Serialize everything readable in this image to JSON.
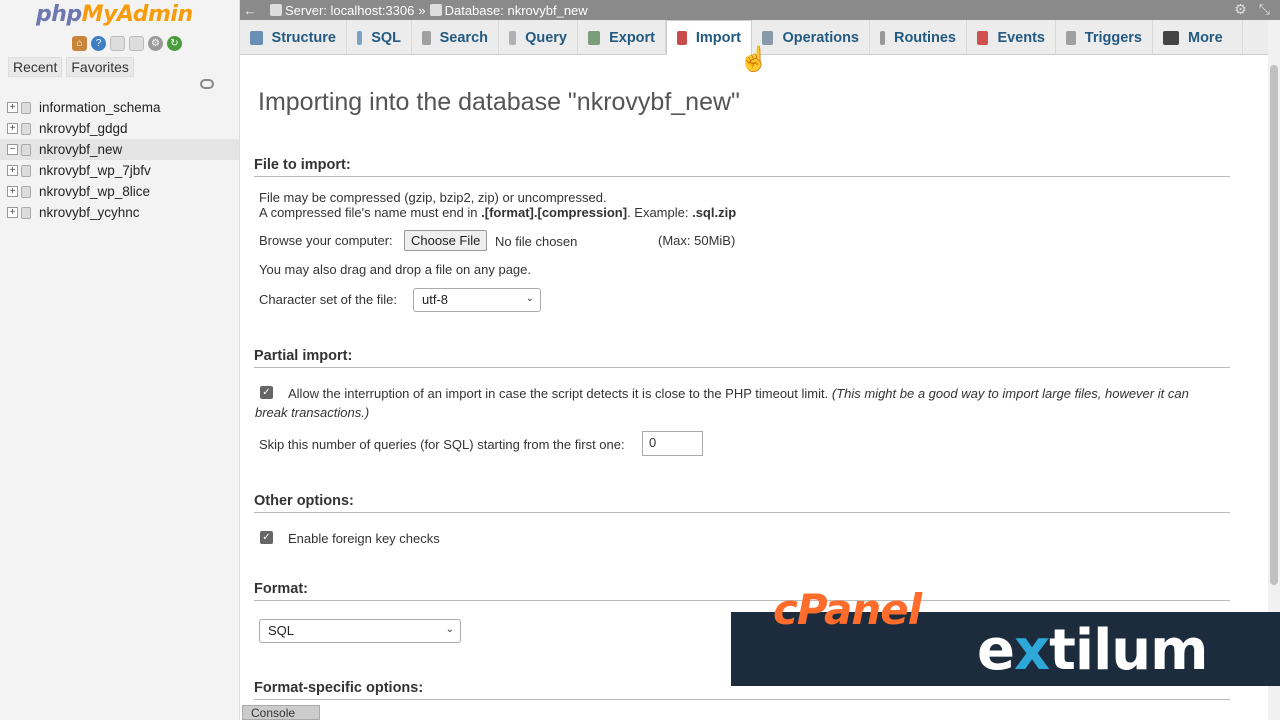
{
  "sidebar": {
    "logo_php": "php",
    "logo_myadmin": "MyAdmin",
    "tabs": [
      "Recent",
      "Favorites"
    ],
    "databases": [
      {
        "name": "information_schema",
        "active": false
      },
      {
        "name": "nkrovybf_gdgd",
        "active": false
      },
      {
        "name": "nkrovybf_new",
        "active": true
      },
      {
        "name": "nkrovybf_wp_7jbfv",
        "active": false
      },
      {
        "name": "nkrovybf_wp_8lice",
        "active": false
      },
      {
        "name": "nkrovybf_ycyhnc",
        "active": false
      }
    ]
  },
  "topbar": {
    "server": "Server: localhost:3306",
    "separator": "»",
    "database": "Database: nkrovybf_new"
  },
  "tabs": [
    {
      "label": "Structure",
      "color": "#6a8fb5"
    },
    {
      "label": "SQL",
      "color": "#7da0c6"
    },
    {
      "label": "Search",
      "color": "#a0a0a0"
    },
    {
      "label": "Query",
      "color": "#b0b0b0"
    },
    {
      "label": "Export",
      "color": "#7c9d7c"
    },
    {
      "label": "Import",
      "color": "#c94c4c"
    },
    {
      "label": "Operations",
      "color": "#8899aa"
    },
    {
      "label": "Routines",
      "color": "#999999"
    },
    {
      "label": "Events",
      "color": "#d05050"
    },
    {
      "label": "Triggers",
      "color": "#a0a0a0"
    },
    {
      "label": "More",
      "color": "#444444"
    }
  ],
  "main": {
    "title": "Importing into the database \"nkrovybf_new\"",
    "file_section": {
      "header": "File to import:",
      "line1": "File may be compressed (gzip, bzip2, zip) or uncompressed.",
      "line2_prefix": "A compressed file's name must end in ",
      "line2_bold": ".[format].[compression]",
      "line2_mid": ". Example: ",
      "line2_example": ".sql.zip",
      "browse_label": "Browse your computer:",
      "choose_file_button": "Choose File",
      "no_file": "No file chosen",
      "max_size": "(Max: 50MiB)",
      "drag_drop": "You may also drag and drop a file on any page.",
      "charset_label": "Character set of the file:",
      "charset_value": "utf-8"
    },
    "partial_section": {
      "header": "Partial import:",
      "allow_interrupt_text": "Allow the interruption of an import in case the script detects it is close to the PHP timeout limit.",
      "allow_interrupt_italic": "(This might be a good way to import large files, however it can",
      "allow_interrupt_italic2": "break transactions.)",
      "allow_interrupt_checked": true,
      "skip_label": "Skip this number of queries (for SQL) starting from the first one:",
      "skip_value": "0"
    },
    "other_section": {
      "header": "Other options:",
      "fk_label": "Enable foreign key checks",
      "fk_checked": true
    },
    "format_section": {
      "header": "Format:",
      "format_value": "SQL"
    },
    "format_specific_header": "Format-specific options:"
  },
  "console_label": "Console",
  "overlay": {
    "cpanel": "cPanel",
    "extilum_prefix": "e",
    "extilum_x": "x",
    "extilum_suffix": "tilum"
  }
}
